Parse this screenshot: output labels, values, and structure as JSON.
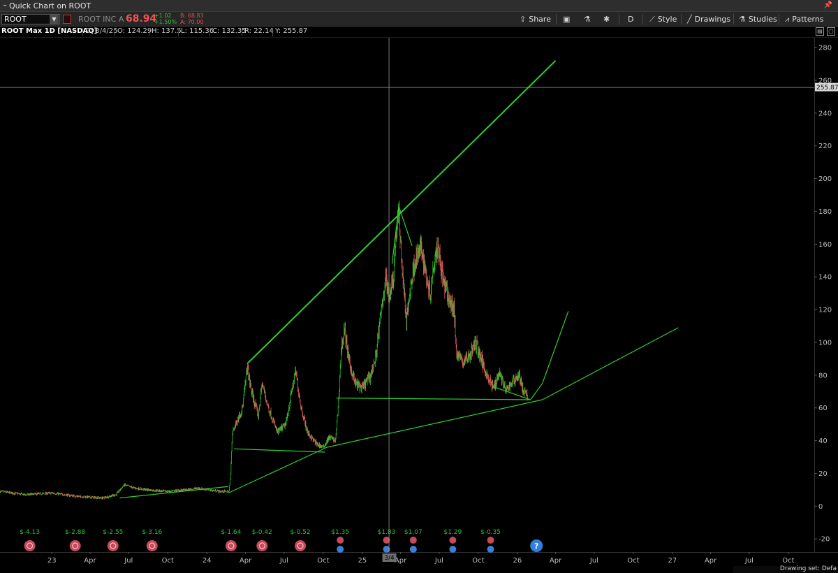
{
  "window": {
    "title": "Quick Chart on ROOT"
  },
  "toolbar": {
    "symbol": "ROOT",
    "company": "ROOT INC A",
    "last_price": "68.94",
    "net_change": "+1.02",
    "net_change_pct": "+1.50%",
    "bid": "B: 68.83",
    "ask": "A: 70.00",
    "share_label": "Share",
    "timeframe_label": "D",
    "style_label": "Style",
    "drawings_label": "Drawings",
    "studies_label": "Studies",
    "patterns_label": "Patterns"
  },
  "infobar": {
    "title": "ROOT Max 1D [NASDAQ]",
    "date": "D: 3/4/25",
    "open": "O: 124.29",
    "high": "H: 137.5",
    "low": "L: 115.36",
    "close": "C: 132.35",
    "range": "R: 22.14",
    "y": "Y: 255.87"
  },
  "status": {
    "drawing_set": "Drawing set: Defa"
  },
  "colors": {
    "up": "#28c428",
    "down": "#e05a5a",
    "drawing": "#2ed02e",
    "grid_text": "#bdbdbd",
    "crosshair": "#9a9a9a",
    "background": "#000000"
  },
  "chart_data": {
    "type": "candlestick",
    "ylim": [
      -28,
      286
    ],
    "y_ticks": [
      -20,
      0,
      20,
      40,
      60,
      80,
      100,
      120,
      140,
      160,
      180,
      200,
      220,
      240,
      260,
      280
    ],
    "x_ticks": [
      "23",
      "Apr",
      "Jul",
      "Oct",
      "24",
      "Apr",
      "Jul",
      "Oct",
      "25",
      "Apr",
      "Jul",
      "Oct",
      "26",
      "Apr",
      "Jul",
      "Oct",
      "27",
      "Apr",
      "Jul",
      "Oct"
    ],
    "x_tick_dates": [
      "2023-01-01",
      "2023-04-01",
      "2023-07-01",
      "2023-10-01",
      "2024-01-01",
      "2024-04-01",
      "2024-07-01",
      "2024-10-01",
      "2025-01-01",
      "2025-04-01",
      "2025-07-01",
      "2025-10-01",
      "2026-01-01",
      "2026-04-01",
      "2026-07-01",
      "2026-10-01",
      "2027-01-01",
      "2027-04-01",
      "2027-07-01",
      "2027-10-01"
    ],
    "x_range": [
      "2022-09-01",
      "2027-12-01"
    ],
    "crosshair": {
      "date": "2025-03-04",
      "value": 255.87,
      "date_label": "3/4",
      "value_label": "255.87"
    },
    "price_path": [
      {
        "date": "2022-09-01",
        "value": 9
      },
      {
        "date": "2022-11-01",
        "value": 7
      },
      {
        "date": "2023-01-01",
        "value": 8
      },
      {
        "date": "2023-03-01",
        "value": 6
      },
      {
        "date": "2023-05-01",
        "value": 5
      },
      {
        "date": "2023-06-01",
        "value": 7
      },
      {
        "date": "2023-06-20",
        "value": 13
      },
      {
        "date": "2023-07-15",
        "value": 11
      },
      {
        "date": "2023-08-15",
        "value": 10
      },
      {
        "date": "2023-10-01",
        "value": 9
      },
      {
        "date": "2023-11-15",
        "value": 10
      },
      {
        "date": "2023-12-10",
        "value": 11
      },
      {
        "date": "2024-01-05",
        "value": 10
      },
      {
        "date": "2024-02-01",
        "value": 9
      },
      {
        "date": "2024-02-22",
        "value": 9
      },
      {
        "date": "2024-02-26",
        "value": 20
      },
      {
        "date": "2024-03-01",
        "value": 45
      },
      {
        "date": "2024-03-12",
        "value": 52
      },
      {
        "date": "2024-03-25",
        "value": 60
      },
      {
        "date": "2024-04-05",
        "value": 85
      },
      {
        "date": "2024-04-15",
        "value": 70
      },
      {
        "date": "2024-05-01",
        "value": 55
      },
      {
        "date": "2024-05-10",
        "value": 75
      },
      {
        "date": "2024-05-25",
        "value": 60
      },
      {
        "date": "2024-06-15",
        "value": 45
      },
      {
        "date": "2024-07-05",
        "value": 50
      },
      {
        "date": "2024-07-20",
        "value": 72
      },
      {
        "date": "2024-07-28",
        "value": 82
      },
      {
        "date": "2024-08-10",
        "value": 60
      },
      {
        "date": "2024-08-25",
        "value": 45
      },
      {
        "date": "2024-09-15",
        "value": 38
      },
      {
        "date": "2024-10-01",
        "value": 36
      },
      {
        "date": "2024-10-15",
        "value": 42
      },
      {
        "date": "2024-10-30",
        "value": 40
      },
      {
        "date": "2024-11-07",
        "value": 68
      },
      {
        "date": "2024-11-12",
        "value": 95
      },
      {
        "date": "2024-11-20",
        "value": 108
      },
      {
        "date": "2024-12-01",
        "value": 88
      },
      {
        "date": "2024-12-15",
        "value": 75
      },
      {
        "date": "2025-01-01",
        "value": 72
      },
      {
        "date": "2025-01-20",
        "value": 80
      },
      {
        "date": "2025-02-01",
        "value": 90
      },
      {
        "date": "2025-02-15",
        "value": 120
      },
      {
        "date": "2025-02-25",
        "value": 140
      },
      {
        "date": "2025-03-04",
        "value": 128
      },
      {
        "date": "2025-03-15",
        "value": 140
      },
      {
        "date": "2025-03-22",
        "value": 168
      },
      {
        "date": "2025-03-28",
        "value": 178
      },
      {
        "date": "2025-04-05",
        "value": 145
      },
      {
        "date": "2025-04-15",
        "value": 112
      },
      {
        "date": "2025-04-25",
        "value": 135
      },
      {
        "date": "2025-05-05",
        "value": 150
      },
      {
        "date": "2025-05-20",
        "value": 158
      },
      {
        "date": "2025-06-01",
        "value": 140
      },
      {
        "date": "2025-06-10",
        "value": 130
      },
      {
        "date": "2025-06-20",
        "value": 152
      },
      {
        "date": "2025-06-28",
        "value": 160
      },
      {
        "date": "2025-07-10",
        "value": 138
      },
      {
        "date": "2025-07-25",
        "value": 125
      },
      {
        "date": "2025-08-05",
        "value": 120
      },
      {
        "date": "2025-08-10",
        "value": 95
      },
      {
        "date": "2025-08-25",
        "value": 88
      },
      {
        "date": "2025-09-10",
        "value": 92
      },
      {
        "date": "2025-09-25",
        "value": 100
      },
      {
        "date": "2025-10-10",
        "value": 88
      },
      {
        "date": "2025-10-25",
        "value": 78
      },
      {
        "date": "2025-11-05",
        "value": 72
      },
      {
        "date": "2025-11-20",
        "value": 82
      },
      {
        "date": "2025-12-05",
        "value": 70
      },
      {
        "date": "2025-12-20",
        "value": 76
      },
      {
        "date": "2026-01-05",
        "value": 80
      },
      {
        "date": "2026-01-15",
        "value": 70
      },
      {
        "date": "2026-01-25",
        "value": 67
      }
    ],
    "trendlines": [
      {
        "from": {
          "date": "2024-04-05",
          "value": 87
        },
        "to": {
          "date": "2026-04-01",
          "value": 272
        }
      },
      {
        "from": {
          "date": "2023-06-10",
          "value": 5
        },
        "to": {
          "date": "2024-02-20",
          "value": 12
        }
      },
      {
        "from": {
          "date": "2024-02-20",
          "value": 8
        },
        "to": {
          "date": "2024-10-10",
          "value": 36
        }
      },
      {
        "from": {
          "date": "2024-10-10",
          "value": 36
        },
        "to": {
          "date": "2026-03-01",
          "value": 65
        }
      },
      {
        "from": {
          "date": "2026-03-01",
          "value": 65
        },
        "to": {
          "date": "2027-01-15",
          "value": 109
        }
      },
      {
        "from": {
          "date": "2024-03-05",
          "value": 35
        },
        "to": {
          "date": "2024-10-05",
          "value": 33
        }
      },
      {
        "from": {
          "date": "2024-11-01",
          "value": 66
        },
        "to": {
          "date": "2026-02-01",
          "value": 65
        }
      },
      {
        "from": {
          "date": "2025-11-05",
          "value": 73
        },
        "to": {
          "date": "2026-02-01",
          "value": 65
        }
      },
      {
        "from": {
          "date": "2025-03-12",
          "value": 148
        },
        "to": {
          "date": "2025-03-28",
          "value": 183
        }
      },
      {
        "from": {
          "date": "2025-03-28",
          "value": 183
        },
        "to": {
          "date": "2025-04-28",
          "value": 159
        }
      },
      {
        "from": {
          "date": "2026-02-01",
          "value": 65
        },
        "to": {
          "date": "2026-03-01",
          "value": 75
        }
      },
      {
        "from": {
          "date": "2026-03-01",
          "value": 75
        },
        "to": {
          "date": "2026-05-01",
          "value": 119
        }
      }
    ],
    "earnings": [
      {
        "date": "2022-11-10",
        "label": "$-4.13",
        "type": "loss"
      },
      {
        "date": "2023-02-25",
        "label": "$-2.88",
        "type": "loss"
      },
      {
        "date": "2023-05-25",
        "label": "$-2.55",
        "type": "loss"
      },
      {
        "date": "2023-08-25",
        "label": "$-3.16",
        "type": "loss"
      },
      {
        "date": "2024-02-27",
        "label": "$-1.64",
        "type": "loss"
      },
      {
        "date": "2024-05-10",
        "label": "$-0.42",
        "type": "loss"
      },
      {
        "date": "2024-08-08",
        "label": "$-0.52",
        "type": "loss"
      },
      {
        "date": "2024-11-10",
        "label": "$1.35",
        "type": "profit"
      },
      {
        "date": "2025-02-27",
        "label": "$1.83",
        "type": "profit"
      },
      {
        "date": "2025-05-01",
        "label": "$1.07",
        "type": "profit"
      },
      {
        "date": "2025-08-02",
        "label": "$1.29",
        "type": "profit"
      },
      {
        "date": "2025-10-30",
        "label": "$-0.35",
        "type": "profit"
      },
      {
        "date": "2026-02-15",
        "label": "?",
        "type": "pending"
      }
    ]
  }
}
